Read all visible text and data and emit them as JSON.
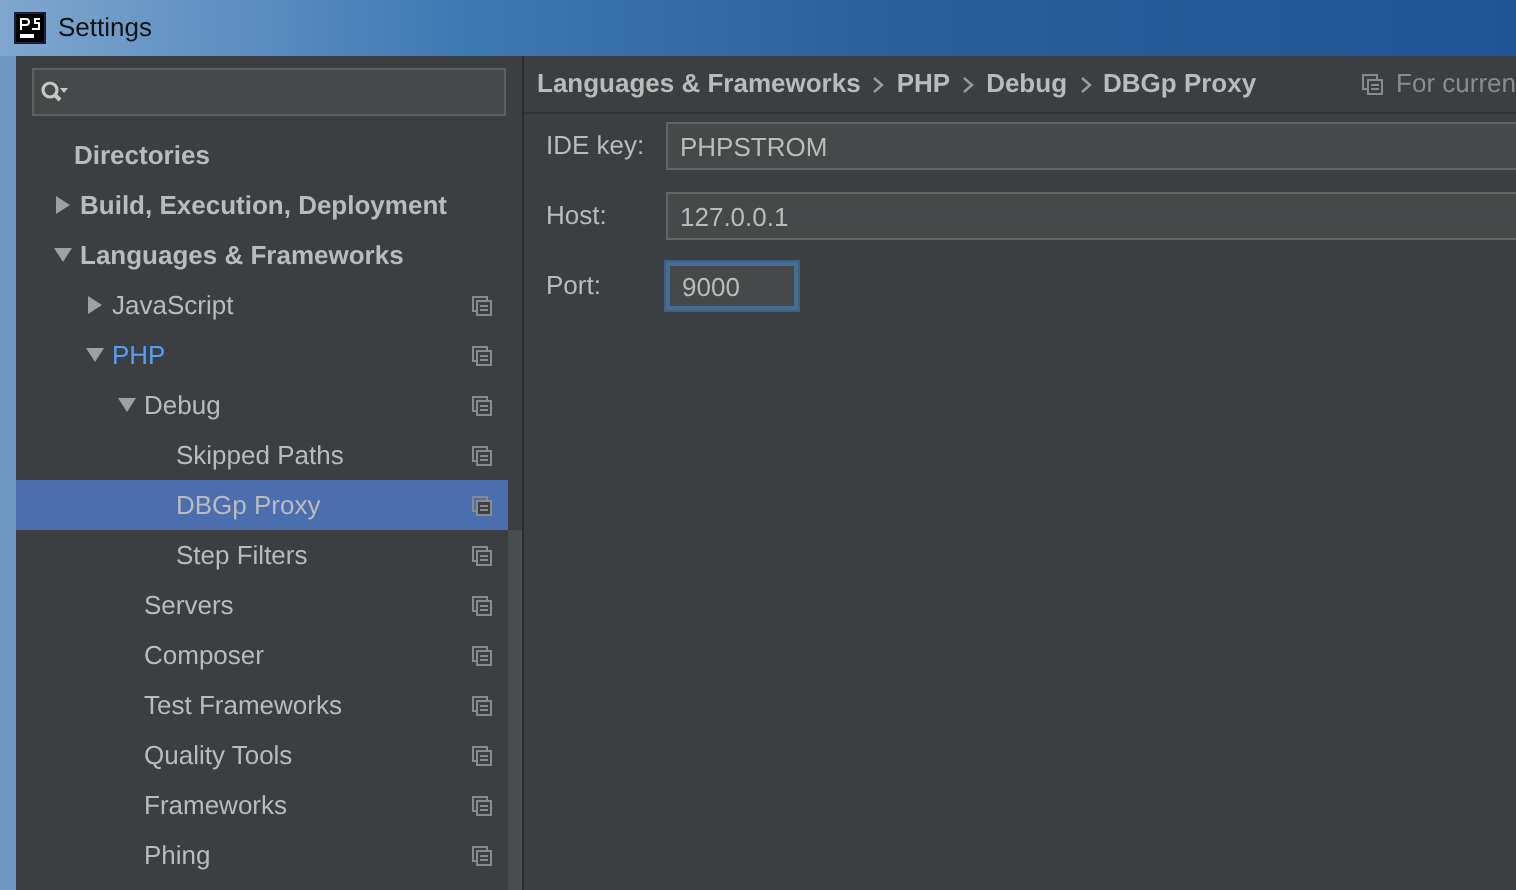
{
  "window": {
    "title": "Settings"
  },
  "tree": [
    {
      "label": "Directories",
      "bold": true,
      "selected": false,
      "highlighted": false,
      "project_scope": false
    },
    {
      "label": "Build, Execution, Deployment",
      "bold": true,
      "expanded": false,
      "selected": false,
      "highlighted": false,
      "project_scope": false
    },
    {
      "label": "Languages & Frameworks",
      "bold": true,
      "expanded": true,
      "selected": false,
      "highlighted": false,
      "project_scope": false,
      "children": [
        {
          "label": "JavaScript",
          "bold": false,
          "expanded": false,
          "selected": false,
          "highlighted": false,
          "project_scope": true
        },
        {
          "label": "PHP",
          "bold": false,
          "expanded": true,
          "selected": false,
          "highlighted": true,
          "project_scope": true,
          "children": [
            {
              "label": "Debug",
              "bold": false,
              "expanded": true,
              "selected": false,
              "highlighted": false,
              "project_scope": true,
              "children": [
                {
                  "label": "Skipped Paths",
                  "bold": false,
                  "selected": false,
                  "highlighted": false,
                  "project_scope": true
                },
                {
                  "label": "DBGp Proxy",
                  "bold": false,
                  "selected": true,
                  "highlighted": false,
                  "project_scope": true
                },
                {
                  "label": "Step Filters",
                  "bold": false,
                  "selected": false,
                  "highlighted": false,
                  "project_scope": true
                }
              ]
            },
            {
              "label": "Servers",
              "bold": false,
              "selected": false,
              "highlighted": false,
              "project_scope": true
            },
            {
              "label": "Composer",
              "bold": false,
              "selected": false,
              "highlighted": false,
              "project_scope": true
            },
            {
              "label": "Test Frameworks",
              "bold": false,
              "selected": false,
              "highlighted": false,
              "project_scope": true
            },
            {
              "label": "Quality Tools",
              "bold": false,
              "selected": false,
              "highlighted": false,
              "project_scope": true
            },
            {
              "label": "Frameworks",
              "bold": false,
              "selected": false,
              "highlighted": false,
              "project_scope": true
            },
            {
              "label": "Phing",
              "bold": false,
              "selected": false,
              "highlighted": false,
              "project_scope": true
            }
          ]
        }
      ]
    }
  ],
  "breadcrumb": [
    "Languages & Frameworks",
    "PHP",
    "Debug",
    "DBGp Proxy"
  ],
  "scope_note": "For curren",
  "fields": [
    {
      "label": "IDE key:",
      "value": "PHPSTROM",
      "focused": false,
      "wide": true
    },
    {
      "label": "Host:",
      "value": "127.0.0.1",
      "focused": false,
      "wide": true
    },
    {
      "label": "Port:",
      "value": "9000",
      "focused": true,
      "wide": false
    }
  ]
}
